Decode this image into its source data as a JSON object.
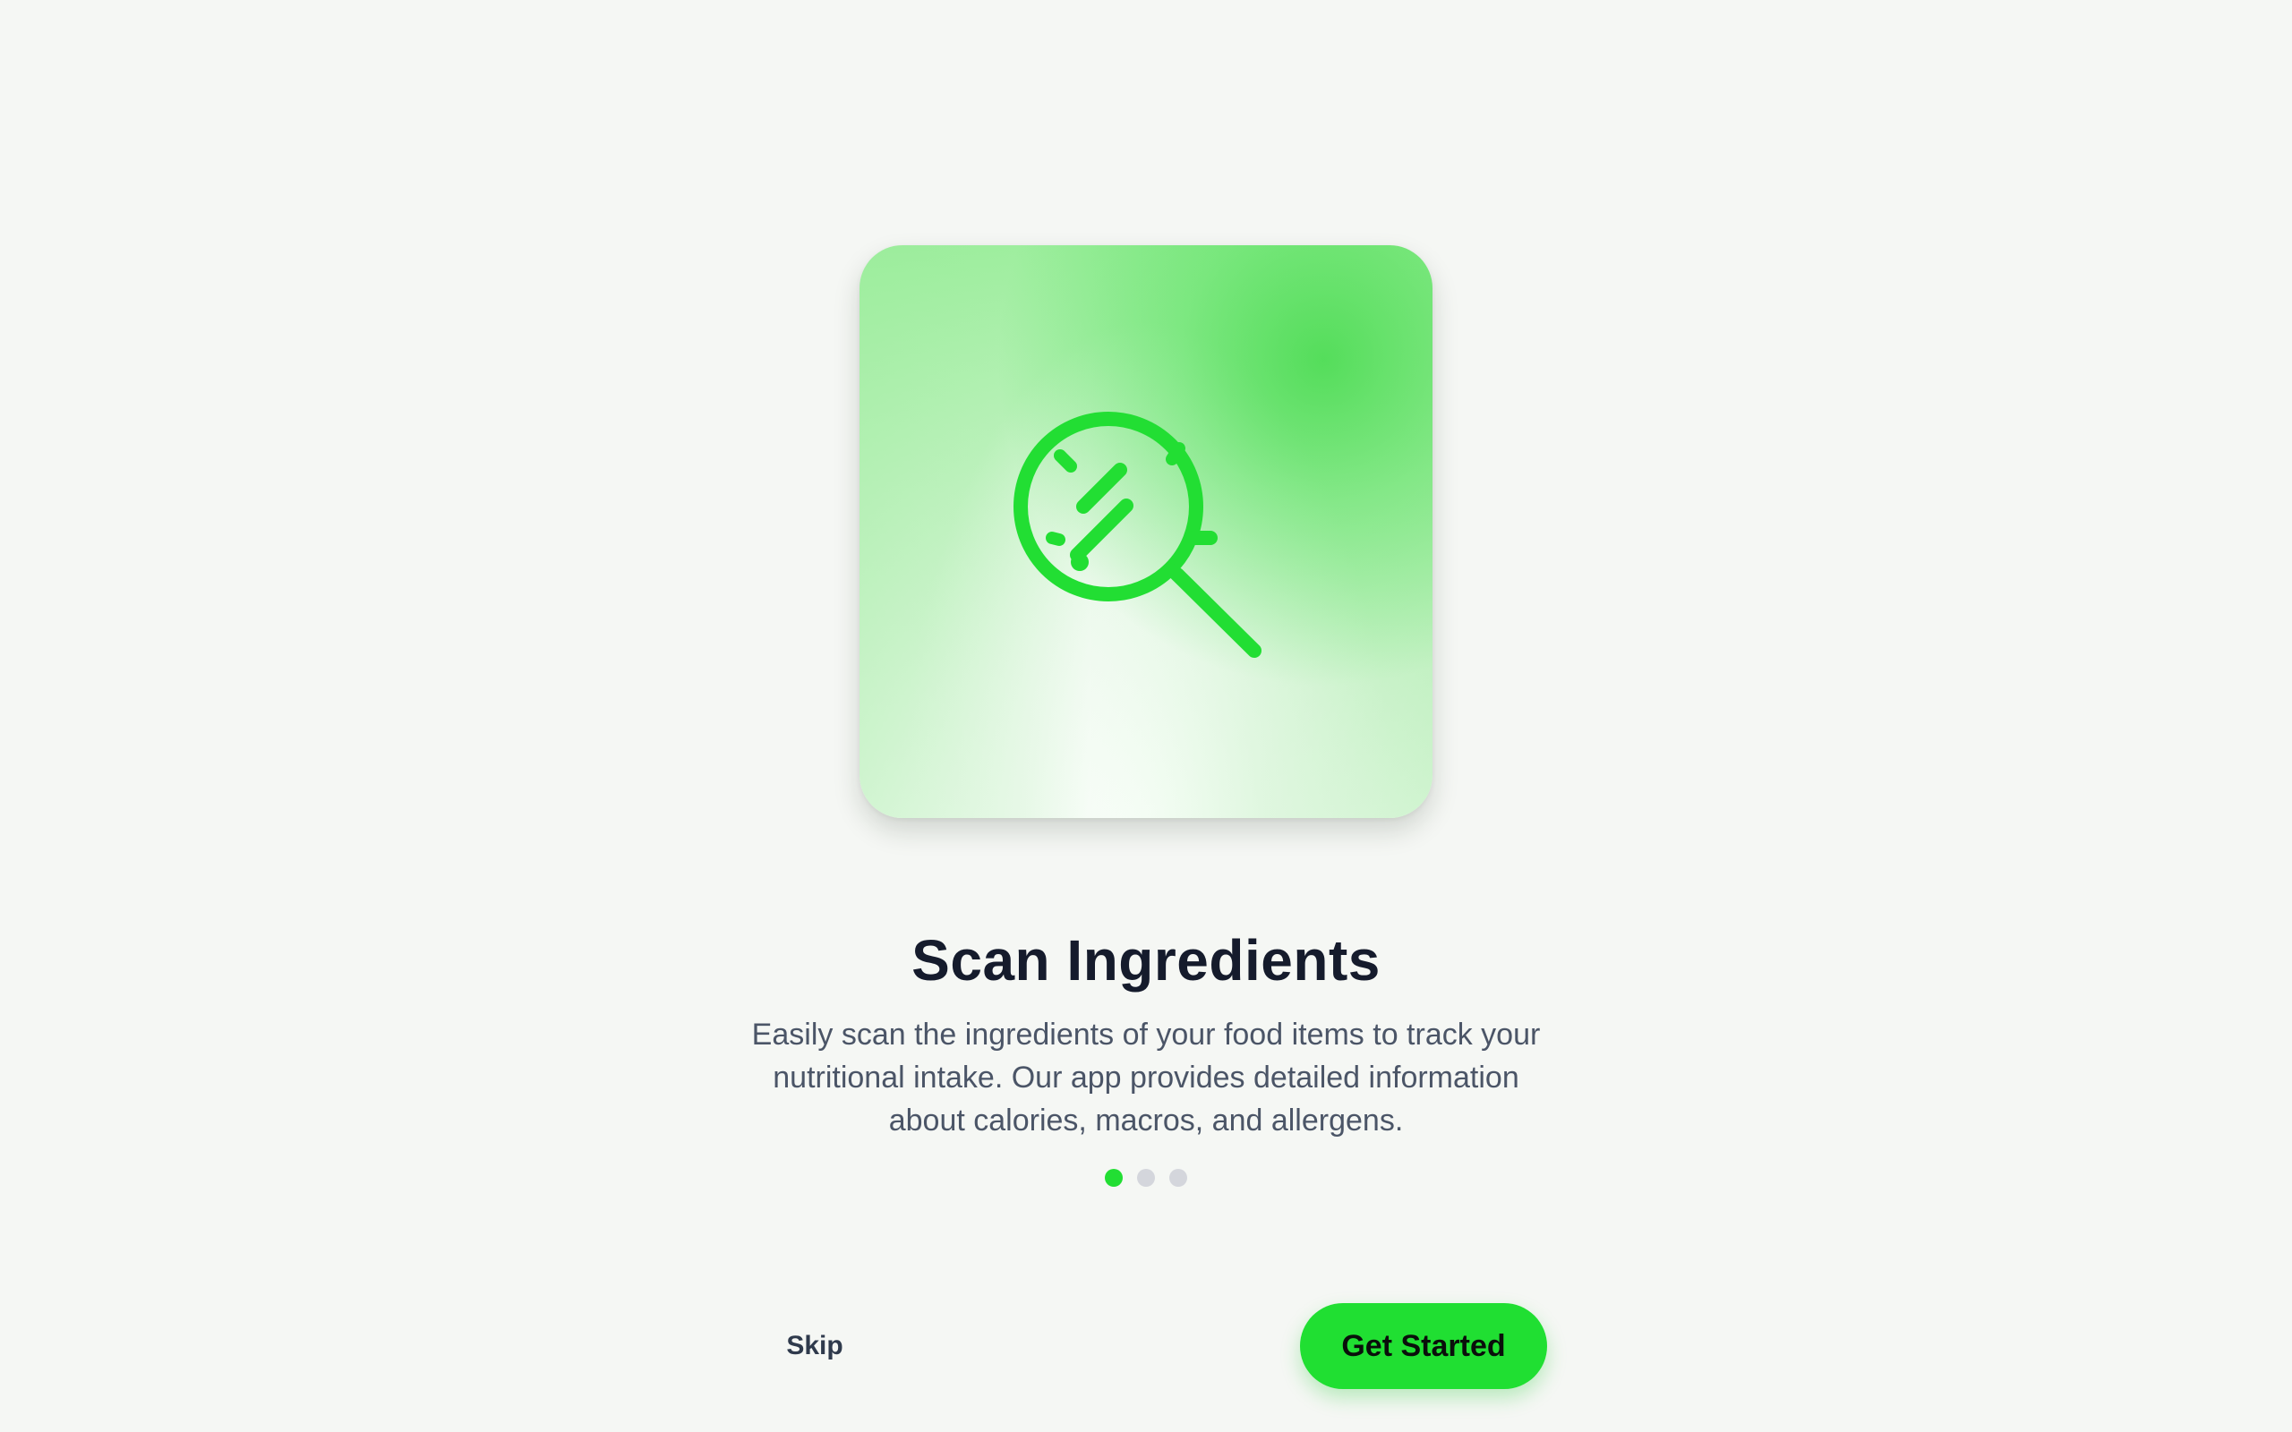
{
  "onboarding": {
    "title": "Scan Ingredients",
    "description": "Easily scan the ingredients of your food items to track your nutritional intake. Our app provides detailed information about calories, macros, and allergens.",
    "illustration_icon": "magnifying-glass-scan-icon",
    "pagination": {
      "total": 3,
      "active_index": 0
    },
    "skip_label": "Skip",
    "cta_label": "Get Started"
  },
  "colors": {
    "accent": "#20df32",
    "title": "#151b2c",
    "body_text": "#4b5567",
    "dot_inactive": "#d4d6dc",
    "background": "#f5f7f4"
  }
}
